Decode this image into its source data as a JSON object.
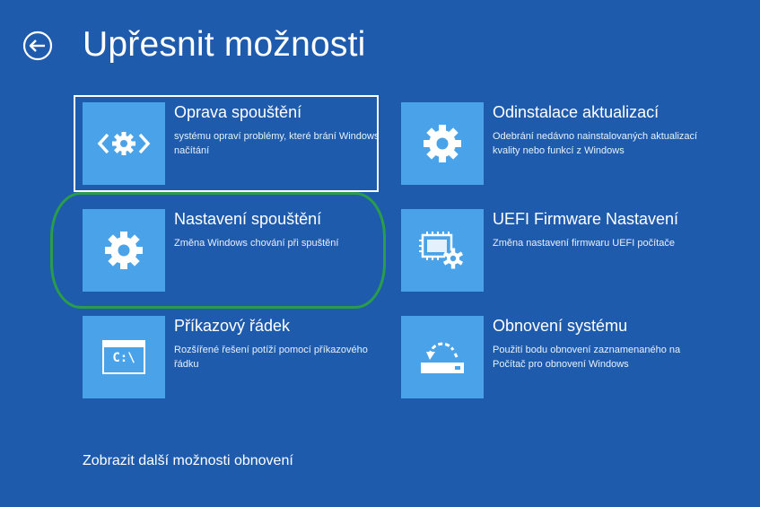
{
  "header": {
    "title": "Upřesnit možnosti"
  },
  "options": [
    {
      "label": "Oprava spouštění",
      "description": "systému opraví problémy, které brání Windows načítání",
      "icon": "startup-repair-icon"
    },
    {
      "label": "Odinstalace aktualizací",
      "description": "Odebrání nedávno nainstalovaných aktualizací kvality nebo funkcí z Windows",
      "icon": "gear-icon"
    },
    {
      "label": "Nastavení spouštění",
      "description": "Změna Windows chování při spuštění",
      "icon": "gear-icon"
    },
    {
      "label": "UEFI  Firmware Nastavení",
      "description": "Změna nastavení firmwaru UEFI počítače",
      "icon": "firmware-chip-gear-icon"
    },
    {
      "label": "Příkazový řádek",
      "description": "Rozšířené řešení potíží pomocí příkazového řádku",
      "icon": "command-prompt-icon",
      "icon_text": "C:\\"
    },
    {
      "label": "Obnovení systému",
      "description": "Použití bodu obnovení zaznamenaného na Počítač pro obnovení Windows",
      "icon": "system-restore-icon"
    }
  ],
  "footer": {
    "more_options_link": "Zobrazit další možnosti obnovení"
  },
  "colors": {
    "background": "#1f5bad",
    "tile": "#4aa3e8",
    "highlight_ring": "#2a9d4a",
    "text": "#ffffff"
  }
}
